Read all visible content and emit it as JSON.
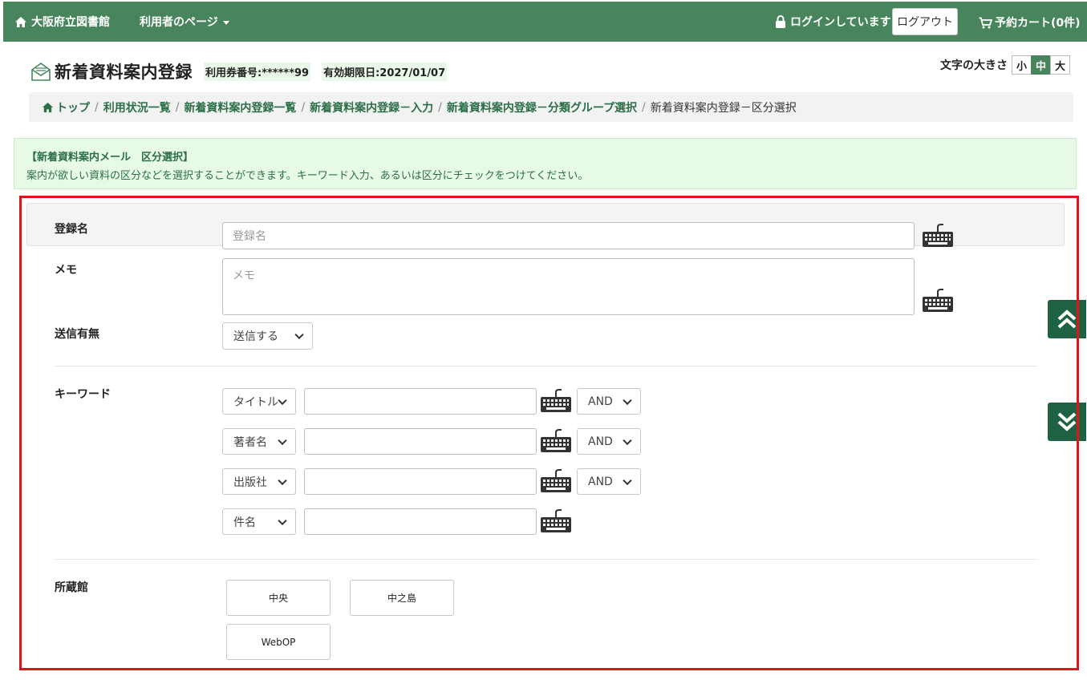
{
  "nav": {
    "home_label": "大阪府立図書館",
    "user_page_label": "利用者のページ",
    "login_status": "ログインしています",
    "logout_label": "ログアウト",
    "cart_label": "予約カート(0件)"
  },
  "header": {
    "title": "新着資料案内登録",
    "card_number": "利用券番号:******99",
    "expiry": "有効期限日:2027/01/07",
    "font_size_label": "文字の大きさ",
    "font_sizes": [
      "小",
      "中",
      "大"
    ],
    "font_size_selected": "中"
  },
  "breadcrumb": {
    "items": [
      "トップ",
      "利用状況一覧",
      "新着資料案内登録一覧",
      "新着資料案内登録－入力",
      "新着資料案内登録－分類グループ選択"
    ],
    "current": "新着資料案内登録－区分選択",
    "separator": "/"
  },
  "info": {
    "title": "【新着資料案内メール　区分選択】",
    "text": "案内が欲しい資料の区分などを選択することができます。キーワード入力、あるいは区分にチェックをつけてください。"
  },
  "form": {
    "name_label": "登録名",
    "name_placeholder": "登録名",
    "memo_label": "メモ",
    "memo_placeholder": "メモ",
    "send_label": "送信有無",
    "send_value": "送信する",
    "keyword_label": "キーワード",
    "keyword_rows": [
      {
        "field": "タイトル",
        "op": "AND"
      },
      {
        "field": "著者名",
        "op": "AND"
      },
      {
        "field": "出版社",
        "op": "AND"
      },
      {
        "field": "件名"
      }
    ],
    "library_label": "所蔵館",
    "libraries": [
      "中央",
      "中之島",
      "WebOP"
    ]
  },
  "colors": {
    "nav_bg": "#48855c",
    "accent_dark": "#1f6243",
    "highlight_frame": "#e0141b",
    "info_bg": "#e6fae6"
  }
}
